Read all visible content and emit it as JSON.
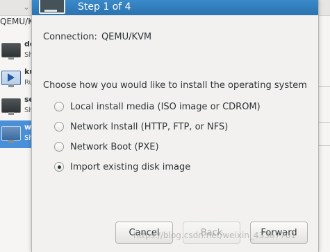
{
  "background_window": {
    "connection_label": "QEMU/KVM",
    "vms": [
      {
        "name": "de",
        "state": "Sh",
        "icon": "monitor-icon",
        "running": false,
        "selected": false
      },
      {
        "name": "ku",
        "state": "Ru",
        "icon": "running-vm-icon",
        "running": true,
        "selected": false
      },
      {
        "name": "se",
        "state": "Sh",
        "icon": "monitor-icon",
        "running": false,
        "selected": false
      },
      {
        "name": "w",
        "state": "Sh",
        "icon": "monitor-icon",
        "running": false,
        "selected": true
      }
    ]
  },
  "dialog": {
    "title": "Step 1 of 4",
    "connection_label": "Connection:",
    "connection_value": "QEMU/KVM",
    "prompt": "Choose how you would like to install the operating system",
    "options": [
      {
        "label": "Local install media (ISO image or CDROM)",
        "checked": false
      },
      {
        "label": "Network Install (HTTP, FTP, or NFS)",
        "checked": false
      },
      {
        "label": "Network Boot (PXE)",
        "checked": false
      },
      {
        "label": "Import existing disk image",
        "checked": true
      }
    ],
    "buttons": {
      "cancel": "Cancel",
      "back": "Back",
      "forward": "Forward"
    }
  },
  "watermark": "https://blog.csdn.net/weixin_43367701",
  "colors": {
    "header": "#2b72b0",
    "selection": "#4a90d9"
  }
}
